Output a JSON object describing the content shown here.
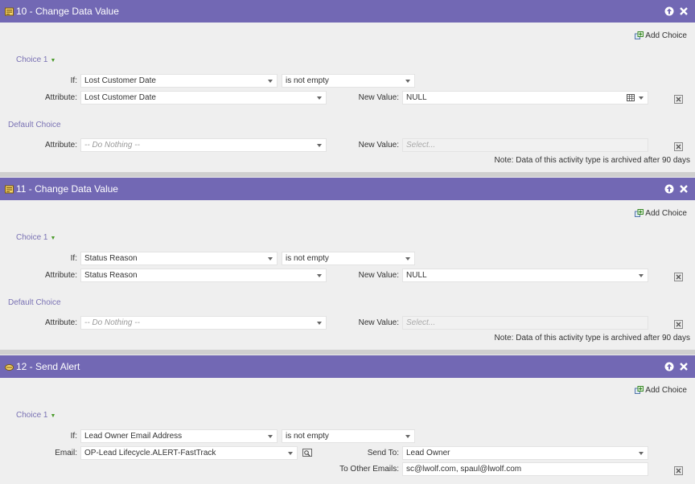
{
  "add_choice_label": "Add Choice",
  "cards": [
    {
      "title": "10 - Change Data Value",
      "choice_label": "Choice 1",
      "if_label": "If:",
      "if_field": "Lost Customer Date",
      "operator": "is not empty",
      "attribute_label": "Attribute:",
      "attribute": "Lost Customer Date",
      "new_value_label": "New Value:",
      "new_value": "NULL",
      "default_label": "Default Choice",
      "default_attribute": "-- Do Nothing --",
      "default_new_value_placeholder": "Select...",
      "note": "Note: Data of this activity type is archived after 90 days"
    },
    {
      "title": "11 - Change Data Value",
      "choice_label": "Choice 1",
      "if_label": "If:",
      "if_field": "Status Reason",
      "operator": "is not empty",
      "attribute_label": "Attribute:",
      "attribute": "Status Reason",
      "new_value_label": "New Value:",
      "new_value": "NULL",
      "default_label": "Default Choice",
      "default_attribute": "-- Do Nothing --",
      "default_new_value_placeholder": "Select...",
      "note": "Note: Data of this activity type is archived after 90 days"
    },
    {
      "title": "12 - Send Alert",
      "choice_label": "Choice 1",
      "if_label": "If:",
      "if_field": "Lead Owner Email Address",
      "operator": "is not empty",
      "email_label": "Email:",
      "email": "OP-Lead Lifecycle.ALERT-FastTrack",
      "send_to_label": "Send To:",
      "send_to": "Lead Owner",
      "other_emails_label": "To Other Emails:",
      "other_emails": "sc@lwolf.com, spaul@lwolf.com"
    }
  ],
  "colors": {
    "header": "#7268b4",
    "choice_label": "#7a72b4",
    "background": "#efefef"
  },
  "icons": {
    "change_data_value": "flow-step-icon",
    "send_alert": "alert-icon",
    "move_up": "arrow-up-icon",
    "close": "close-icon",
    "add_choice": "add-choice-icon",
    "delete": "delete-icon",
    "preview": "preview-icon",
    "date_picker": "calendar-grid-icon"
  }
}
